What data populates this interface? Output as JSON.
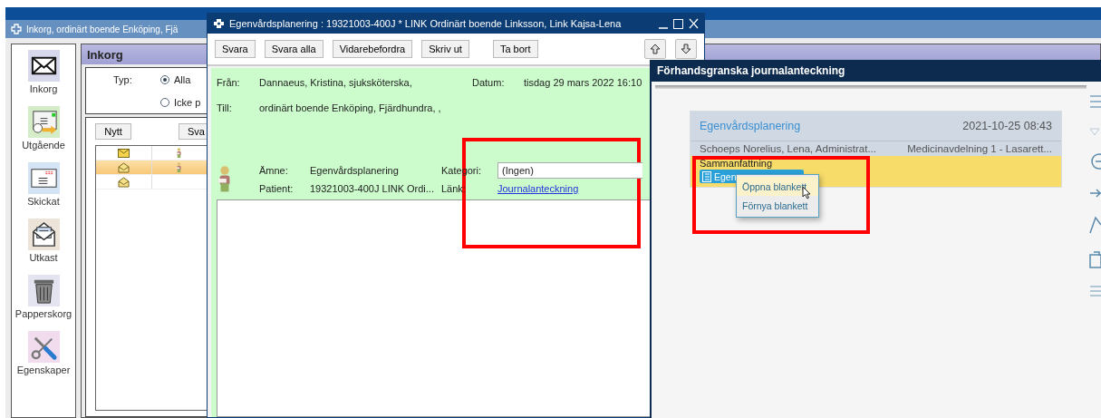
{
  "background_window": {
    "title": "Inkorg, ordinärt boende Enköping, Fjä",
    "sidebar": [
      {
        "kind": "inbox",
        "label": "Inkorg"
      },
      {
        "kind": "outbox",
        "label": "Utgående"
      },
      {
        "kind": "sent",
        "label": "Skickat"
      },
      {
        "kind": "drafts",
        "label": "Utkast"
      },
      {
        "kind": "trash",
        "label": "Papperskorg"
      },
      {
        "kind": "settings",
        "label": "Egenskaper"
      }
    ],
    "panel_title": "Inkorg",
    "filter": {
      "label": "Typ:",
      "options": [
        {
          "label": "Alla",
          "selected": true
        },
        {
          "label": "Icke p",
          "selected": false
        }
      ]
    },
    "buttons": [
      "Nytt",
      "Sva"
    ],
    "rows": [
      {
        "read": false,
        "patient": true,
        "selected": false
      },
      {
        "read": true,
        "patient": true,
        "selected": true
      },
      {
        "read": true,
        "patient": false,
        "selected": false
      }
    ]
  },
  "message_window": {
    "title": "Egenvårdsplanering : 19321003-400J * LINK Ordinärt boende Linksson, Link Kajsa-Lena",
    "buttons": [
      "Svara",
      "Svara alla",
      "Vidarebefordra",
      "Skriv ut",
      "Ta bort"
    ],
    "from_label": "Från:",
    "from": "Dannaeus, Kristina, sjuksköterska,",
    "date_label": "Datum:",
    "date": "tisdag 29 mars 2022 16:10",
    "to_label": "Till:",
    "to": "ordinärt boende Enköping, Fjärdhundra, ,",
    "subject_label": "Ämne:",
    "subject": "Egenvårdsplanering",
    "category_label": "Kategori:",
    "category": "(Ingen)",
    "patient_label": "Patient:",
    "patient": "19321003-400J LINK Ordi...",
    "link_label": "Länk:",
    "link": "Journalanteckning"
  },
  "preview_window": {
    "title": "Förhandsgranska journalanteckning",
    "note": {
      "title": "Egenvårdsplanering",
      "date": "2021-10-25 08:43",
      "author": "Schoeps Norelius, Lena, Administrat...",
      "unit": "Medicinavdelning 1 - Lasarett...",
      "section": "Sammanfattning",
      "chip": "Egen"
    },
    "menu": [
      {
        "label": "Öppna blankett",
        "selected": true
      },
      {
        "label": "Förnya blankett",
        "selected": false
      }
    ]
  }
}
